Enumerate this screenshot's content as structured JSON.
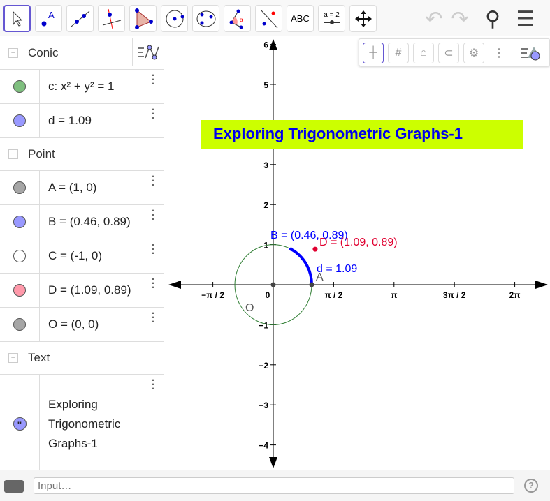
{
  "toolbar": {
    "tools": [
      {
        "name": "move-tool",
        "label": ""
      },
      {
        "name": "point-tool",
        "label": "A"
      },
      {
        "name": "line-tool",
        "label": ""
      },
      {
        "name": "perpendicular-tool",
        "label": ""
      },
      {
        "name": "polygon-tool",
        "label": ""
      },
      {
        "name": "circle-tool",
        "label": ""
      },
      {
        "name": "conic-tool",
        "label": ""
      },
      {
        "name": "angle-tool",
        "label": ""
      },
      {
        "name": "reflect-tool",
        "label": ""
      },
      {
        "name": "text-tool",
        "label": "ABC"
      },
      {
        "name": "slider-tool",
        "label": "a = 2"
      },
      {
        "name": "move-graphics-tool",
        "label": ""
      }
    ]
  },
  "algebra": {
    "groups": [
      {
        "title": "Conic",
        "items": [
          {
            "label": "c: x² + y² = 1",
            "color": "#7fbf7f"
          },
          {
            "label": "d = 1.09",
            "color": "#9999ff"
          }
        ]
      },
      {
        "title": "Point",
        "items": [
          {
            "label": "A = (1, 0)",
            "color": "#a6a6a6"
          },
          {
            "label": "B = (0.46, 0.89)",
            "color": "#9999ff"
          },
          {
            "label": "C = (-1, 0)",
            "color": "#ffffff"
          },
          {
            "label": "D = (1.09, 0.89)",
            "color": "#ff99aa"
          },
          {
            "label": "O = (0, 0)",
            "color": "#a6a6a6"
          }
        ]
      },
      {
        "title": "Text",
        "items": [
          {
            "label": "Exploring Trigonometric Graphs-1",
            "color": "#9999ff"
          }
        ]
      }
    ]
  },
  "graph": {
    "title": "Exploring Trigonometric Graphs-1",
    "title_bg": "#ccff00",
    "title_color": "#0000ee",
    "x_ticks": [
      "−π / 2",
      "0",
      "π / 2",
      "π",
      "3π / 2",
      "2π"
    ],
    "y_ticks": [
      "6",
      "5",
      "4",
      "3",
      "2",
      "1",
      "−1",
      "−2",
      "−3",
      "−4"
    ],
    "labels": {
      "B": "B = (0.46, 0.89)",
      "D": "D = (1.09, 0.89)",
      "d": "d = 1.09",
      "A": "A",
      "O": "O"
    }
  },
  "input": {
    "placeholder": "Input…"
  }
}
